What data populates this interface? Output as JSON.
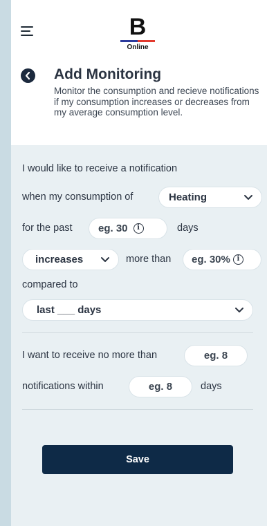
{
  "header": {
    "logo_letter": "B",
    "logo_sub": "Online",
    "title": "Add Monitoring",
    "description": "Monitor the consumption and recieve notifications if my consumption increases or decreases from my average consumption level."
  },
  "form": {
    "line1": "I would like to receive a notification",
    "line2_prefix": "when my consumption of",
    "consumption_type": "Heating",
    "line3_prefix": "for the past",
    "days_placeholder": "eg. 30",
    "line3_suffix": "days",
    "direction": "increases",
    "more_than": "more than",
    "percent_placeholder": "eg. 30%",
    "compared_to": "compared to",
    "period": "last ___ days",
    "limit_prefix": "I want to receive no more than",
    "limit_placeholder": "eg. 8",
    "within_prefix": "notifications within",
    "within_placeholder": "eg. 8",
    "within_suffix": "days"
  },
  "actions": {
    "save_label": "Save"
  },
  "colors": {
    "primary": "#0e2a47",
    "background": "#e9f0f3",
    "outer": "#c9dbe3",
    "logo_blue": "#2b3a9c",
    "logo_red": "#e23a2e"
  },
  "icons": [
    "menu-icon",
    "back-arrow-icon",
    "chevron-down-icon",
    "info-icon"
  ]
}
